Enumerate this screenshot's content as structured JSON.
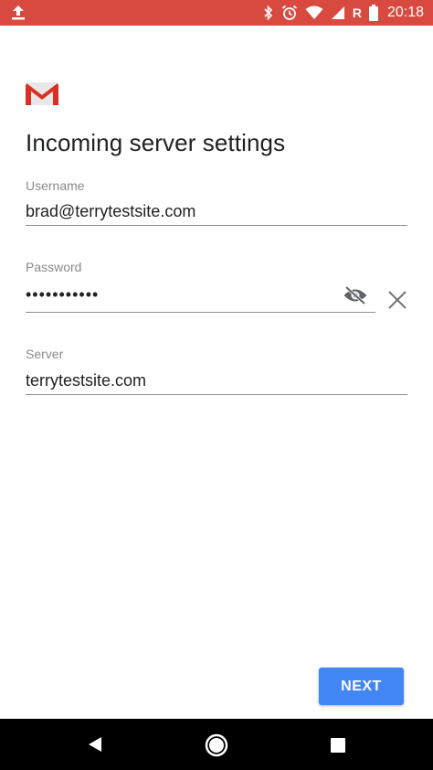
{
  "status_bar": {
    "time": "20:18",
    "carrier_indicator": "R",
    "icons": [
      "upload-icon",
      "bluetooth-icon",
      "alarm-icon",
      "wifi-icon",
      "signal-icon",
      "battery-icon"
    ]
  },
  "app": {
    "logo": "gmail-logo"
  },
  "page": {
    "title": "Incoming server settings"
  },
  "form": {
    "username": {
      "label": "Username",
      "value": "brad@terrytestsite.com"
    },
    "password": {
      "label": "Password",
      "value": "•••••••••••"
    },
    "server": {
      "label": "Server",
      "value": "terrytestsite.com"
    }
  },
  "actions": {
    "next_label": "NEXT"
  },
  "colors": {
    "status_bar": "#d84a3f",
    "accent": "#4285f4",
    "gmail_red": "#d93025"
  }
}
